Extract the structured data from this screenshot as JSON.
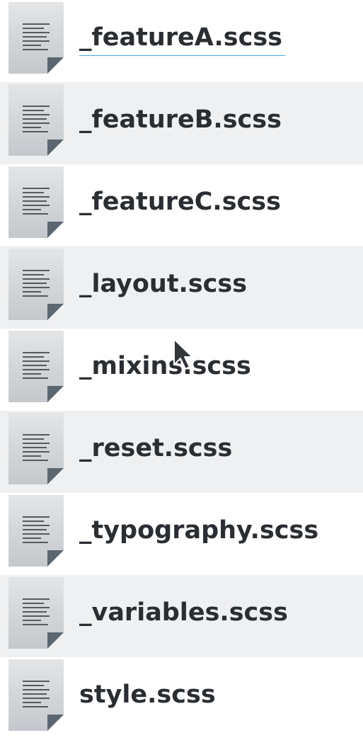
{
  "files": [
    {
      "name": "_featureA.scss",
      "icon": "text-file-icon"
    },
    {
      "name": "_featureB.scss",
      "icon": "text-file-icon"
    },
    {
      "name": "_featureC.scss",
      "icon": "text-file-icon"
    },
    {
      "name": "_layout.scss",
      "icon": "text-file-icon"
    },
    {
      "name": "_mixins.scss",
      "icon": "text-file-icon"
    },
    {
      "name": "_reset.scss",
      "icon": "text-file-icon"
    },
    {
      "name": "_typography.scss",
      "icon": "text-file-icon"
    },
    {
      "name": "_variables.scss",
      "icon": "text-file-icon"
    },
    {
      "name": "style.scss",
      "icon": "text-file-icon"
    }
  ],
  "colors": {
    "alt_row": "#eff0f1",
    "text": "#2a2e32",
    "focus_underline": "#3daee9",
    "icon_page": "#d6d9db",
    "icon_lines": "#4d4d4d",
    "icon_fold": "#5c6670"
  }
}
